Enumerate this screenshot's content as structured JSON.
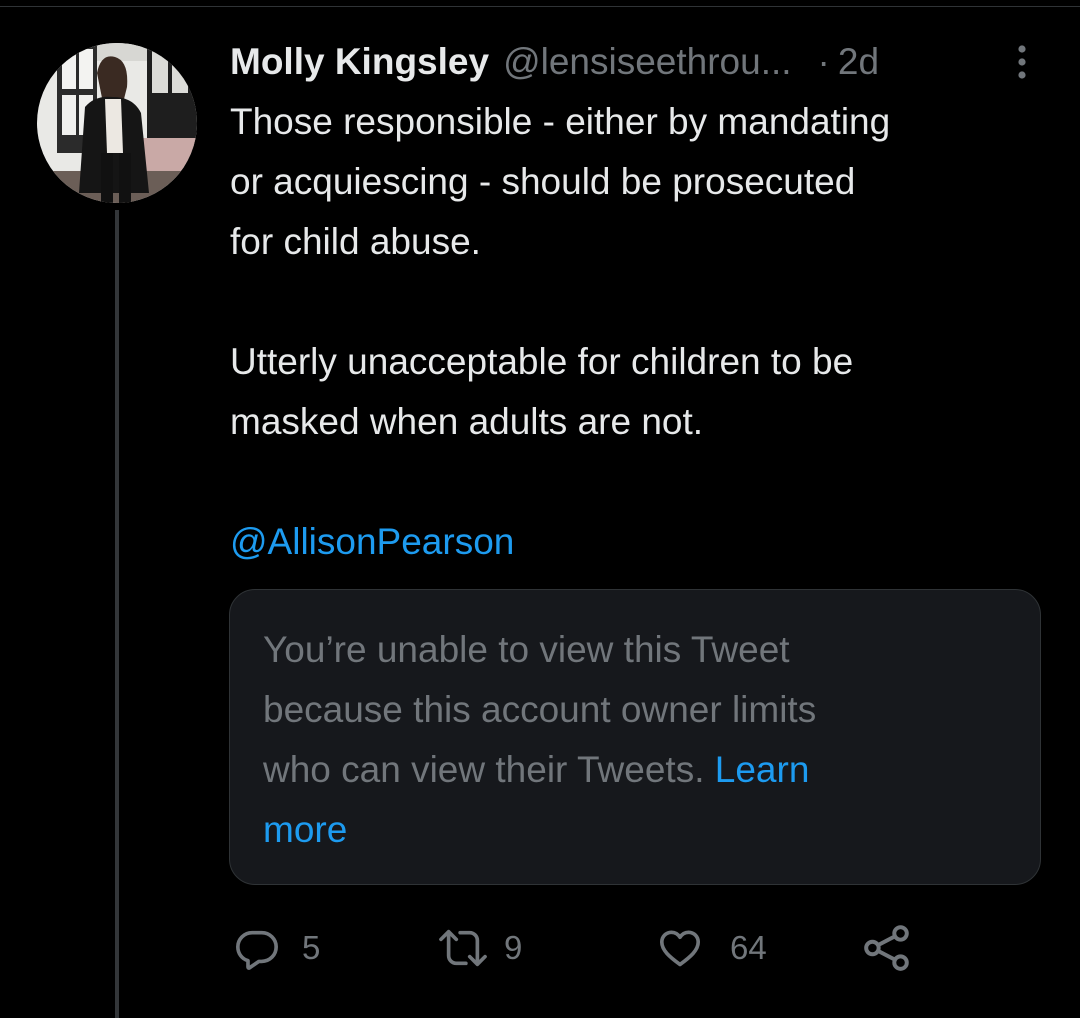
{
  "tweet": {
    "author_name": "Molly Kingsley",
    "handle": "@lensiseethrou...",
    "separator": "·",
    "time": "2d",
    "text_lines": [
      "Those responsible - either by mandating",
      "or acquiescing - should be prosecuted",
      "for child abuse."
    ],
    "text_lines_2": [
      "Utterly unacceptable for children to be",
      "masked when adults are not."
    ],
    "mention": "@AllisonPearson"
  },
  "quoted_tweet": {
    "message_lines": [
      "You’re unable to view this Tweet",
      "because this account owner limits",
      "who can view their Tweets. "
    ],
    "learn": "Learn",
    "more": "more"
  },
  "actions": {
    "reply_count": "5",
    "retweet_count": "9",
    "like_count": "64"
  },
  "icons": {
    "reply": "reply-icon",
    "retweet": "retweet-icon",
    "like": "heart-icon",
    "share": "share-icon",
    "more": "more-vertical-icon"
  },
  "colors": {
    "background": "#000000",
    "text": "#e7e9ea",
    "muted": "#71767b",
    "link": "#1d9bf0",
    "quote_bg": "#16181c",
    "border": "#2f3336"
  }
}
